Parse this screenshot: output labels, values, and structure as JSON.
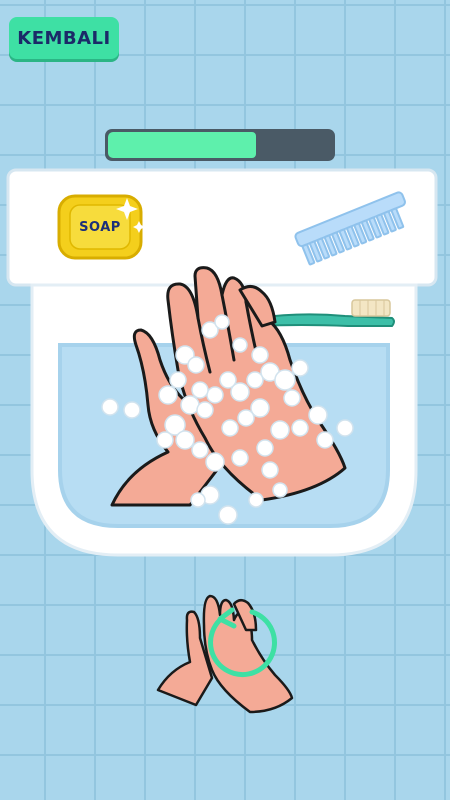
{
  "header": {
    "back_label": "KEMBALI"
  },
  "progress": {
    "value": 0.66
  },
  "soap": {
    "label": "SOAP"
  },
  "hint": {
    "gesture": "rub-palms-circular",
    "icon": "rotate-arrow-icon"
  },
  "colors": {
    "accent": "#3ee0a4",
    "tile": "#a9d6ec",
    "skin": "#f4aa96",
    "soap": "#f4cf1c",
    "comb": "#b9dcfa",
    "toothbrush": "#3dbfa8",
    "water": "#b7ddf3"
  }
}
